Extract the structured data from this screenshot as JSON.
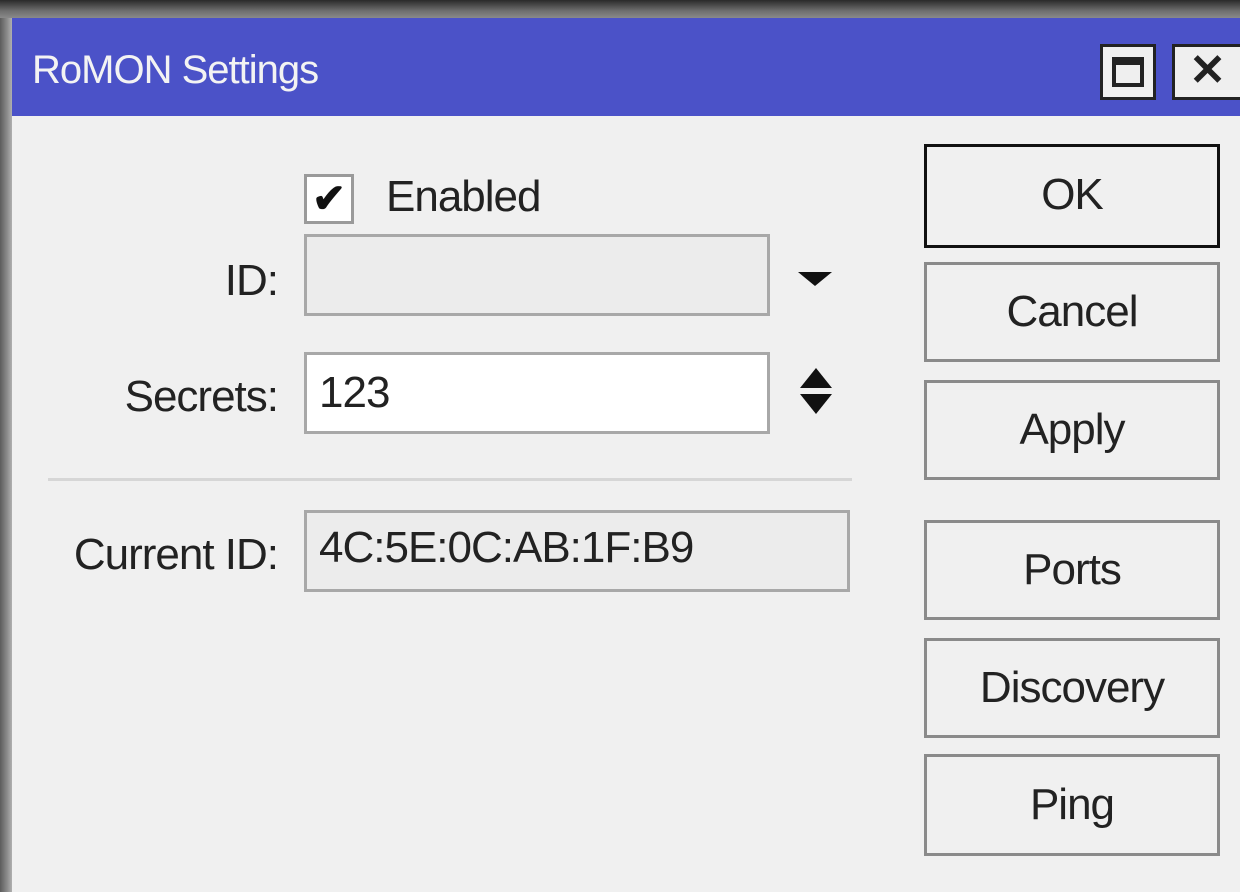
{
  "window": {
    "title": "RoMON Settings",
    "maximize_icon": "maximize-icon",
    "close_icon": "close-icon",
    "titlebar_color": "#4b52c8"
  },
  "form": {
    "enabled": {
      "label": "Enabled",
      "checked": true
    },
    "id": {
      "label": "ID:",
      "value": ""
    },
    "secrets": {
      "label": "Secrets:",
      "value": "123"
    },
    "current_id": {
      "label": "Current ID:",
      "value": "4C:5E:0C:AB:1F:B9"
    }
  },
  "buttons": {
    "ok": "OK",
    "cancel": "Cancel",
    "apply": "Apply",
    "ports": "Ports",
    "discovery": "Discovery",
    "ping": "Ping"
  }
}
